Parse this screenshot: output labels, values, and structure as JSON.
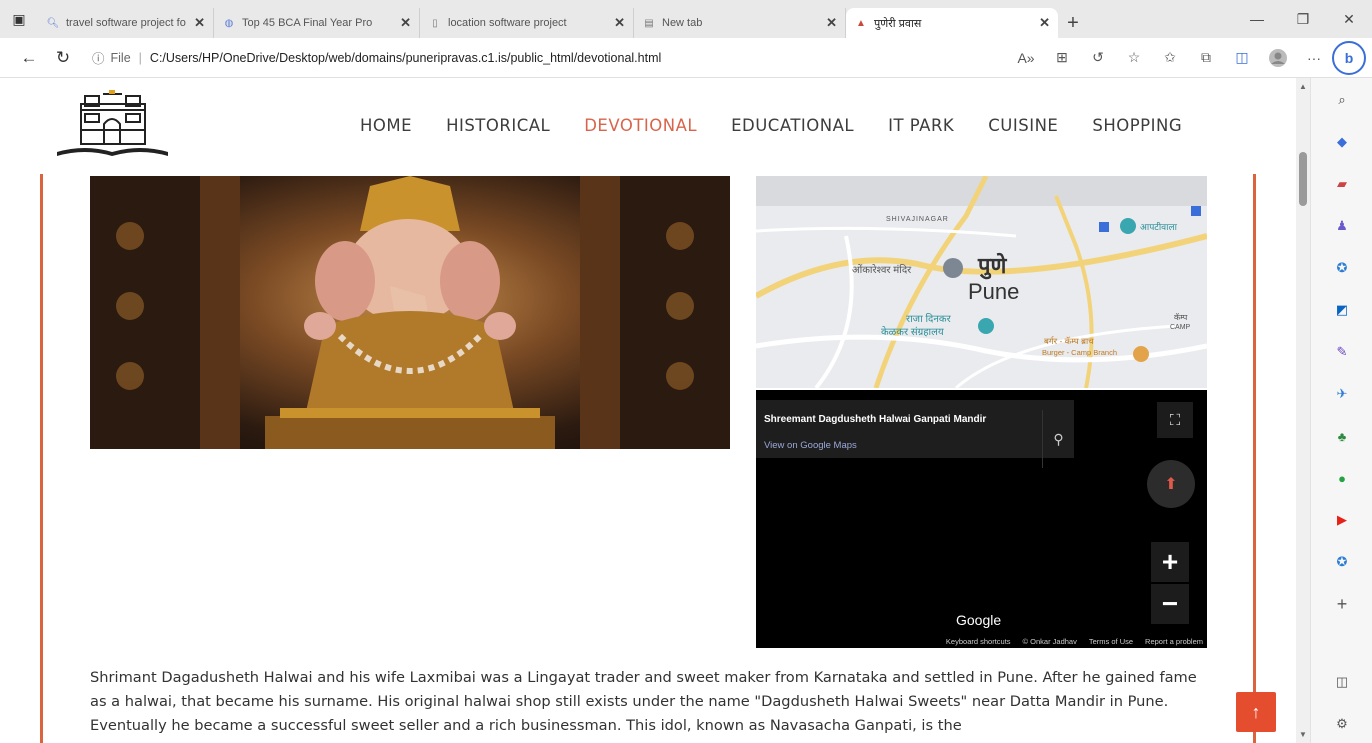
{
  "browser": {
    "tabs": [
      {
        "title": "travel software project fo",
        "icon": "search-tab-icon"
      },
      {
        "title": "Top 45 BCA Final Year Pro",
        "icon": "globe-tab-icon"
      },
      {
        "title": "location software project",
        "icon": "page-tab-icon"
      },
      {
        "title": "New tab",
        "icon": "newtab-icon"
      },
      {
        "title": "पुणेरी प्रवास",
        "icon": "site-favicon",
        "active": true
      }
    ],
    "address": {
      "scheme_label": "File",
      "url": "C:/Users/HP/OneDrive/Desktop/web/domains/puneripravas.c1.is/public_html/devotional.html"
    }
  },
  "site": {
    "nav": [
      "HOME",
      "HISTORICAL",
      "DEVOTIONAL",
      "EDUCATIONAL",
      "IT PARK",
      "CUISINE",
      "SHOPPING"
    ],
    "active_nav": "DEVOTIONAL"
  },
  "map": {
    "labels": {
      "area_top": "SHIVAJINAGAR",
      "place_marathi_top": "आपटीवाला",
      "temple_marathi": "ओंकारेश्वर मंदिर",
      "city_marathi": "पुणे",
      "city": "Pune",
      "museum_marathi_1": "राजा दिनकर",
      "museum_marathi_2": "केळकर संग्रहालय",
      "camp_marathi": "कॅम्प",
      "camp": "CAMP",
      "burger_marathi": "बर्गर - कॅम्प ब्राच",
      "burger": "Burger - Camp Branch"
    }
  },
  "embed": {
    "place_name": "Shreemant Dagdusheth Halwai Ganpati Mandir",
    "view_link": "View on Google Maps",
    "google": "Google",
    "footer": [
      "Keyboard shortcuts",
      "© Onkar Jadhav",
      "Terms of Use",
      "Report a problem"
    ]
  },
  "content": {
    "paragraph": "Shrimant Dagadusheth Halwai and his wife Laxmibai was a Lingayat trader and sweet maker from Karnataka and settled in Pune. After he gained fame as a halwai, that became his surname. His original halwai shop still exists under the name \"Dagdusheth Halwai Sweets\" near Datta Mandir in Pune. Eventually he became a successful sweet seller and a rich businessman. This idol, known as Navasacha Ganpati, is the"
  },
  "colors": {
    "accent": "#d9644b",
    "frame": "#d9643f",
    "scroll_btn": "#e44d2e"
  }
}
